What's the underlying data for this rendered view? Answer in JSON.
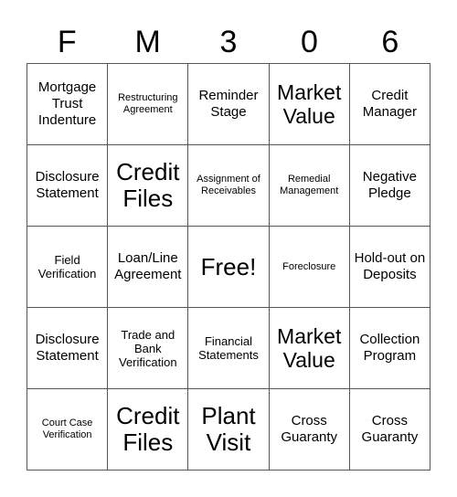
{
  "card": {
    "title_letters": [
      "F",
      "M",
      "3",
      "0",
      "6"
    ],
    "colors": {
      "background": "#ffffff",
      "border": "#555555",
      "text": "#000000"
    },
    "grid": {
      "rows": 5,
      "columns": 5,
      "cells": [
        {
          "text": "Mortgage Trust Indenture",
          "size": "md"
        },
        {
          "text": "Restructuring Agreement",
          "size": "xs"
        },
        {
          "text": "Reminder Stage",
          "size": "md"
        },
        {
          "text": "Market Value",
          "size": "lg"
        },
        {
          "text": "Credit Manager",
          "size": "md"
        },
        {
          "text": "Disclosure Statement",
          "size": "md"
        },
        {
          "text": "Credit Files",
          "size": "xl"
        },
        {
          "text": "Assignment of Receivables",
          "size": "xs"
        },
        {
          "text": "Remedial Management",
          "size": "xs"
        },
        {
          "text": "Negative Pledge",
          "size": "md"
        },
        {
          "text": "Field Verification",
          "size": "sm"
        },
        {
          "text": "Loan/Line Agreement",
          "size": "md"
        },
        {
          "text": "Free!",
          "size": "xl"
        },
        {
          "text": "Foreclosure",
          "size": "xs"
        },
        {
          "text": "Hold-out on Deposits",
          "size": "md"
        },
        {
          "text": "Disclosure Statement",
          "size": "md"
        },
        {
          "text": "Trade and Bank Verification",
          "size": "sm"
        },
        {
          "text": "Financial Statements",
          "size": "sm"
        },
        {
          "text": "Market Value",
          "size": "lg"
        },
        {
          "text": "Collection Program",
          "size": "md"
        },
        {
          "text": "Court Case Verification",
          "size": "xs"
        },
        {
          "text": "Credit Files",
          "size": "xl"
        },
        {
          "text": "Plant Visit",
          "size": "xl"
        },
        {
          "text": "Cross Guaranty",
          "size": "md"
        },
        {
          "text": "Cross Guaranty",
          "size": "md"
        }
      ]
    }
  }
}
